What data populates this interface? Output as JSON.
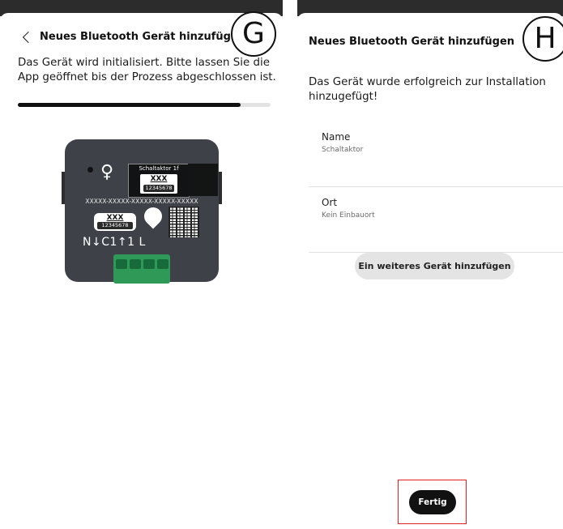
{
  "panels": {
    "g": {
      "badge": "G",
      "title": "Neues Bluetooth Gerät hinzufügen",
      "message_line1": "Das Gerät wird initialisiert. Bitte lassen Sie die",
      "message_line2": "App geöffnet bis der Prozess abgeschlossen ist.",
      "progress_percent": 88,
      "device": {
        "plate_label": "Schaltaktor 1f",
        "plate_code": "XXX",
        "plate_number": "12345678",
        "serial_line": "XXXXX-XXXXX-XXXXX-XXXXX-XXXXX",
        "label_code": "XXX",
        "label_number": "12345678",
        "pins": "N↓C1↑1 L"
      }
    },
    "h": {
      "badge": "H",
      "title": "Neues Bluetooth Gerät hinzufügen",
      "message_line1": "Das Gerät wurde erfolgreich zur Installation",
      "message_line2": "hinzugefügt!",
      "fields": [
        {
          "label": "Name",
          "value": "Schaltaktor"
        },
        {
          "label": "Ort",
          "value": "Kein Einbauort"
        }
      ],
      "add_another_button": "Ein weiteres Gerät hinzufügen",
      "done_button": "Fertig"
    }
  },
  "colors": {
    "primary_button": "#111111",
    "secondary_button": "#e4e4e4",
    "highlight": "#e02020",
    "terminal_green": "#2f9a58"
  }
}
